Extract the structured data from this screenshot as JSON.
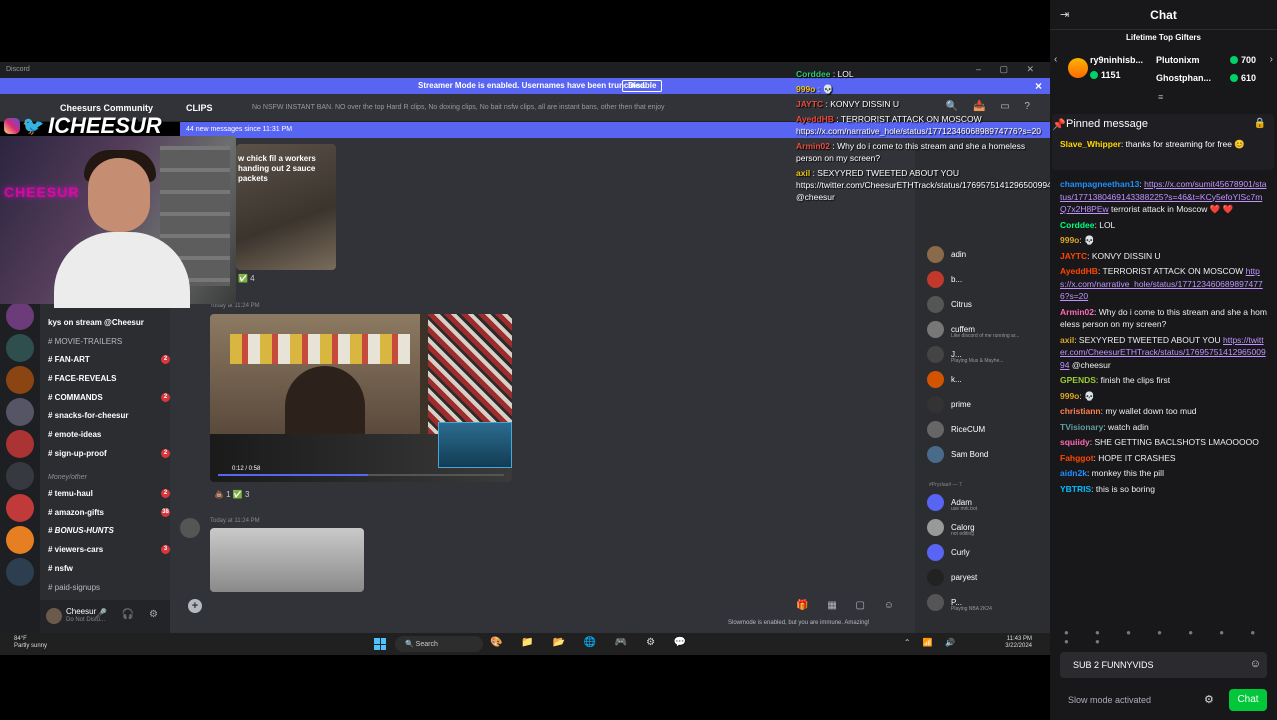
{
  "discord": {
    "app_name": "Discord",
    "streamer_banner": "Streamer Mode is enabled. Usernames have been truncated.",
    "disable_label": "Disable",
    "server_name": "Cheesurs Community",
    "channel_name": "CLIPS",
    "topic": "No NSFW INSTANT BAN. NO over the top Hard R clips, No doxing clips, No bait nsfw clips, all are instant bans, other then that enjoy",
    "new_messages": "44 new messages since 11:31 PM",
    "channels": [
      {
        "label": "kys on stream @Cheesur",
        "bold": true,
        "badge": ""
      },
      {
        "label": "MOVIE-TRAILERS",
        "bold": false,
        "badge": ""
      },
      {
        "label": "FAN-ART",
        "bold": true,
        "badge": "2"
      },
      {
        "label": "FACE-REVEALS",
        "bold": true,
        "badge": ""
      },
      {
        "label": "COMMANDS",
        "bold": true,
        "badge": "2"
      },
      {
        "label": "snacks-for-cheesur",
        "bold": true,
        "badge": ""
      },
      {
        "label": "emote-ideas",
        "bold": true,
        "badge": ""
      },
      {
        "label": "sign-up-proof",
        "bold": true,
        "badge": "2"
      }
    ],
    "category_label": "Money/other",
    "channels2": [
      {
        "label": "temu-haul",
        "bold": true,
        "badge": "2"
      },
      {
        "label": "amazon-gifts",
        "bold": true,
        "badge": "38"
      },
      {
        "label": "BONUS-HUNTS",
        "bold": true,
        "badge": ""
      },
      {
        "label": "viewers-cars",
        "bold": true,
        "badge": "3"
      },
      {
        "label": "nsfw",
        "bold": true,
        "badge": ""
      },
      {
        "label": "paid-signups",
        "bold": false,
        "badge": ""
      }
    ],
    "user": {
      "name": "Cheesur",
      "status": "Do Not Distu..."
    },
    "clip1_caption": "w chick fil a workers handing out 2 sauce packets",
    "reaction1": "✅ 4",
    "msg2_header": "Today at 11:24 PM",
    "video_time": "0:12 / 0:58",
    "reaction2": "💩 1   ✅ 3",
    "msg3_header": "Today at 11:24 PM",
    "slowmode_note": "Slowmode is enabled, but you are immune. Amazing!",
    "members": [
      {
        "name": "adin",
        "sub": "",
        "color": "#8a6a4a"
      },
      {
        "name": "b...",
        "sub": "",
        "color": "#c0392b"
      },
      {
        "name": "Citrus",
        "sub": "",
        "color": "#555"
      },
      {
        "name": "cuffem",
        "sub": "Like discord of me running ar...",
        "color": "#777"
      },
      {
        "name": "J...",
        "sub": "Playing Mus & Mayhe...",
        "color": "#444"
      },
      {
        "name": "k...",
        "sub": "",
        "color": "#d35400"
      },
      {
        "name": "prime",
        "sub": "",
        "color": "#333"
      },
      {
        "name": "RiceCUM",
        "sub": "",
        "color": "#666"
      },
      {
        "name": "Sam Bond",
        "sub": "",
        "color": "#4a6a8a"
      }
    ],
    "member_category": "#Pryzlaa# — 7",
    "members2": [
      {
        "name": "Adam",
        "sub": "use mrk.bot",
        "color": "#5865f2"
      },
      {
        "name": "Calorg",
        "sub": "not editing",
        "color": "#999"
      },
      {
        "name": "Curly",
        "sub": "",
        "color": "#5865f2"
      },
      {
        "name": "paryest",
        "sub": "",
        "color": "#222"
      },
      {
        "name": "P...",
        "sub": "Playing NBA 2K24",
        "color": "#555"
      }
    ]
  },
  "stream_overlay": {
    "handle": "ICHEESUR",
    "neon_sign": "CHEESUR",
    "messages": [
      {
        "user": "Corddee",
        "color": "#2ecc71",
        "text": "LOL"
      },
      {
        "user": "999o",
        "color": "#f1c40f",
        "text": "💀"
      },
      {
        "user": "JAYTC",
        "color": "#e74c3c",
        "text": "KONVY DISSIN U"
      },
      {
        "user": "AyeddHB",
        "color": "#e74c3c",
        "text": "TERRORIST ATTACK ON MOSCOW https://x.com/narrative_hole/status/1771234606898974776?s=20"
      },
      {
        "user": "Armin02",
        "color": "#e74c3c",
        "text": "Why do i come to this stream and she a homeless person on my screen?"
      },
      {
        "user": "axil",
        "color": "#f1c40f",
        "text": "SEXYYRED TWEETED ABOUT YOU https://twitter.com/CheesurETHTrack/status/1769575141296500994 @cheesur"
      }
    ]
  },
  "taskbar": {
    "weather_temp": "84°F",
    "weather_desc": "Partly sunny",
    "search_placeholder": "Search",
    "time": "11:43 PM",
    "date": "3/22/2024"
  },
  "chat": {
    "title": "Chat",
    "gifters_title": "Lifetime Top Gifters",
    "gifters": [
      {
        "name": "ry9ninhisb...",
        "count": "1151"
      },
      {
        "name": "Plutonixm",
        "count": "700"
      },
      {
        "name": "Ghostphan...",
        "count": "610"
      }
    ],
    "pinned_title": "Pinned message",
    "pinned": {
      "user": "Slave_Whipper",
      "text": "thanks for streaming for free 😊"
    },
    "messages": [
      {
        "user": "champagneethan13",
        "color": "#1e90ff",
        "text": "",
        "link": "https://x.com/sumit45678901/status/1771380469143388225?s=46&t=KCy5efoYISc7mQ7x2H8PEw",
        "tail": "terrorist attack in Moscow ❤️ ❤️"
      },
      {
        "user": "Corddee",
        "color": "#00ff7f",
        "text": "LOL",
        "link": "",
        "tail": ""
      },
      {
        "user": "999o",
        "color": "#daa520",
        "text": "💀",
        "link": "",
        "tail": ""
      },
      {
        "user": "JAYTC",
        "color": "#ff4500",
        "text": "KONVY DISSIN U",
        "link": "",
        "tail": ""
      },
      {
        "user": "AyeddHB",
        "color": "#ff4500",
        "text": "TERRORIST ATTACK ON MOSCOW",
        "link": "https://x.com/narrative_hole/status/1771234606898974776?s=20",
        "tail": ""
      },
      {
        "user": "Armin02",
        "color": "#ff69b4",
        "text": "Why do i come to this stream and she a homeless person on my screen?",
        "link": "",
        "tail": ""
      },
      {
        "user": "axil",
        "color": "#daa520",
        "text": "SEXYYRED TWEETED ABOUT YOU",
        "link": "https://twitter.com/CheesurETHTrack/status/1769575141296500994",
        "tail": "@cheesur"
      },
      {
        "user": "GPENDS",
        "color": "#9acd32",
        "text": "finish the clips first",
        "link": "",
        "tail": ""
      },
      {
        "user": "999o",
        "color": "#daa520",
        "text": "💀",
        "link": "",
        "tail": ""
      },
      {
        "user": "christiann",
        "color": "#ff7f50",
        "text": "my wallet down too mud",
        "link": "",
        "tail": ""
      },
      {
        "user": "TVisionary",
        "color": "#5f9ea0",
        "text": "watch adin",
        "link": "",
        "tail": ""
      },
      {
        "user": "squiidy",
        "color": "#ff69b4",
        "text": "SHE GETTING BACLSHOTS LMAOOOOO",
        "link": "",
        "tail": ""
      },
      {
        "user": "Fahggot",
        "color": "#ff4500",
        "text": "HOPE IT CRASHES",
        "link": "",
        "tail": ""
      },
      {
        "user": "aidn2k",
        "color": "#1e90ff",
        "text": "monkey this the pill",
        "link": "",
        "tail": ""
      },
      {
        "user": "YBTRIS",
        "color": "#00bfff",
        "text": "this is so boring",
        "link": "",
        "tail": ""
      }
    ],
    "input_value": "SUB 2 FUNNYVIDS",
    "slow_mode": "Slow mode activated",
    "chat_button": "Chat"
  },
  "colors": {
    "discord_blurple": "#5865f2",
    "twitch_bg": "#18181b",
    "chat_button": "#00c83a"
  }
}
